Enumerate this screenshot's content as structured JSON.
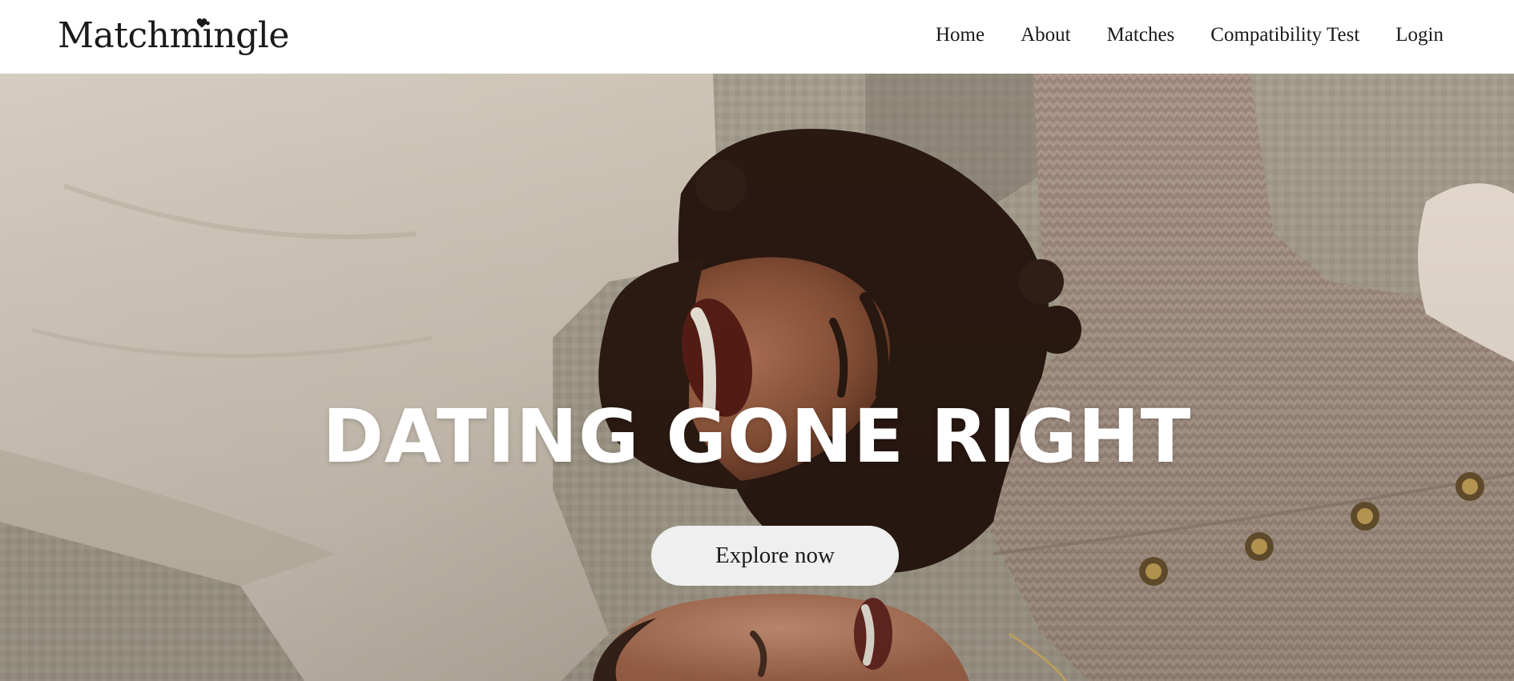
{
  "header": {
    "logo_text": "Matchmingle",
    "nav": [
      {
        "id": "home",
        "label": "Home"
      },
      {
        "id": "about",
        "label": "About"
      },
      {
        "id": "matches",
        "label": "Matches"
      },
      {
        "id": "compatibility-test",
        "label": "Compatibility Test"
      },
      {
        "id": "login",
        "label": "Login"
      }
    ]
  },
  "hero": {
    "title": "DATING GONE RIGHT",
    "cta_label": "Explore now",
    "photo": "laughing couple lying on a blanket"
  },
  "colors": {
    "header_bg": "#ffffff",
    "text": "#1a1a1a",
    "hero_title": "#ffffff",
    "button_bg": "#efefef",
    "blanket": "#a9a18f",
    "shirt": "#d9d0c2",
    "sweater": "#a8968a",
    "hair": "#2b1a12",
    "skin": "#9a5e45"
  }
}
